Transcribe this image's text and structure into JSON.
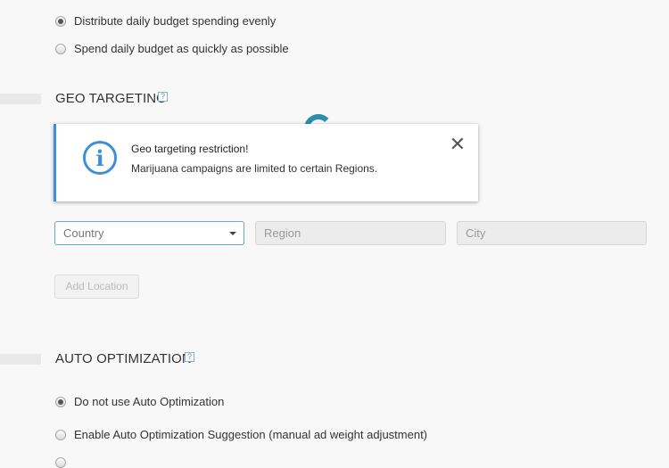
{
  "budget": {
    "options": [
      {
        "label": "Distribute daily budget spending evenly",
        "checked": true
      },
      {
        "label": "Spend daily budget as quickly as possible",
        "checked": false
      }
    ]
  },
  "geo": {
    "title": "GEO TARGETING",
    "help": "?",
    "alert": {
      "title": "Geo targeting restriction!",
      "message": "Marijuana campaigns are limited to certain Regions.",
      "icon": "info-icon",
      "close": "✕"
    },
    "country": {
      "value": "Country"
    },
    "region": {
      "placeholder": "Region"
    },
    "city": {
      "placeholder": "City"
    },
    "add_button": "Add Location"
  },
  "auto": {
    "title": "AUTO OPTIMIZATION",
    "help": "?",
    "options": [
      {
        "label": "Do not use Auto Optimization",
        "checked": true
      },
      {
        "label": "Enable Auto Optimization Suggestion (manual ad weight adjustment)",
        "checked": false
      }
    ]
  },
  "colors": {
    "accent": "#3f8fd6",
    "spinner": "#2a8eaa"
  }
}
